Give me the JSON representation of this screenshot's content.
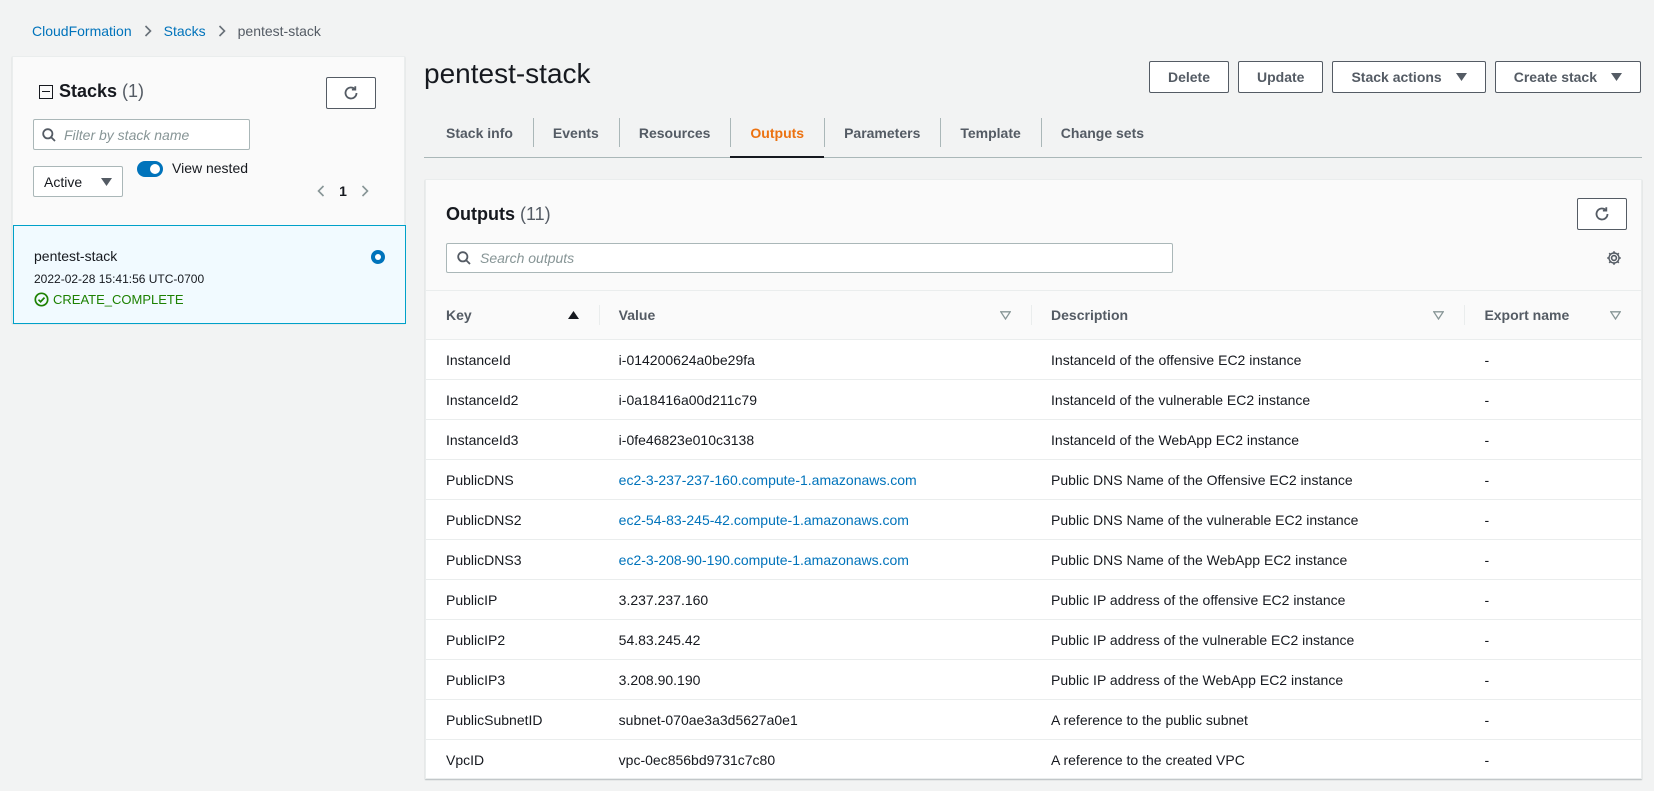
{
  "breadcrumb": {
    "items": [
      {
        "label": "CloudFormation"
      },
      {
        "label": "Stacks"
      },
      {
        "label": "pentest-stack"
      }
    ]
  },
  "sidebar": {
    "title": "Stacks",
    "count": "(1)",
    "filter_placeholder": "Filter by stack name",
    "status_filter": "Active",
    "view_nested_label": "View nested",
    "view_nested_on": true,
    "page": "1",
    "stack": {
      "name": "pentest-stack",
      "created": "2022-02-28 15:41:56 UTC-0700",
      "status": "CREATE_COMPLETE",
      "status_color": "#1d8102"
    }
  },
  "header": {
    "title": "pentest-stack",
    "buttons": {
      "delete": "Delete",
      "update": "Update",
      "stack_actions": "Stack actions",
      "create_stack": "Create stack"
    }
  },
  "tabs": [
    {
      "label": "Stack info",
      "active": false
    },
    {
      "label": "Events",
      "active": false
    },
    {
      "label": "Resources",
      "active": false
    },
    {
      "label": "Outputs",
      "active": true
    },
    {
      "label": "Parameters",
      "active": false
    },
    {
      "label": "Template",
      "active": false
    },
    {
      "label": "Change sets",
      "active": false
    }
  ],
  "outputs": {
    "title": "Outputs",
    "count": "(11)",
    "search_placeholder": "Search outputs",
    "columns": {
      "key": "Key",
      "value": "Value",
      "description": "Description",
      "export": "Export name"
    },
    "rows": [
      {
        "key": "InstanceId",
        "value": "i-014200624a0be29fa",
        "is_link": false,
        "description": "InstanceId of the offensive EC2 instance",
        "export": "-"
      },
      {
        "key": "InstanceId2",
        "value": "i-0a18416a00d211c79",
        "is_link": false,
        "description": "InstanceId of the vulnerable EC2 instance",
        "export": "-"
      },
      {
        "key": "InstanceId3",
        "value": "i-0fe46823e010c3138",
        "is_link": false,
        "description": "InstanceId of the WebApp EC2 instance",
        "export": "-"
      },
      {
        "key": "PublicDNS",
        "value": "ec2-3-237-237-160.compute-1.amazonaws.com",
        "is_link": true,
        "description": "Public DNS Name of the Offensive EC2 instance",
        "export": "-"
      },
      {
        "key": "PublicDNS2",
        "value": "ec2-54-83-245-42.compute-1.amazonaws.com",
        "is_link": true,
        "description": "Public DNS Name of the vulnerable EC2 instance",
        "export": "-"
      },
      {
        "key": "PublicDNS3",
        "value": "ec2-3-208-90-190.compute-1.amazonaws.com",
        "is_link": true,
        "description": "Public DNS Name of the WebApp EC2 instance",
        "export": "-"
      },
      {
        "key": "PublicIP",
        "value": "3.237.237.160",
        "is_link": false,
        "description": "Public IP address of the offensive EC2 instance",
        "export": "-"
      },
      {
        "key": "PublicIP2",
        "value": "54.83.245.42",
        "is_link": false,
        "description": "Public IP address of the vulnerable EC2 instance",
        "export": "-"
      },
      {
        "key": "PublicIP3",
        "value": "3.208.90.190",
        "is_link": false,
        "description": "Public IP address of the WebApp EC2 instance",
        "export": "-"
      },
      {
        "key": "PublicSubnetID",
        "value": "subnet-070ae3a3d5627a0e1",
        "is_link": false,
        "description": "A reference to the public subnet",
        "export": "-"
      },
      {
        "key": "VpcID",
        "value": "vpc-0ec856bd9731c7c80",
        "is_link": false,
        "description": "A reference to the created VPC",
        "export": "-"
      }
    ]
  },
  "colors": {
    "link": "#0073bb",
    "active_tab": "#ec7211",
    "selected_card_bg": "#f1faff",
    "selected_card_border": "#00a1c9"
  }
}
